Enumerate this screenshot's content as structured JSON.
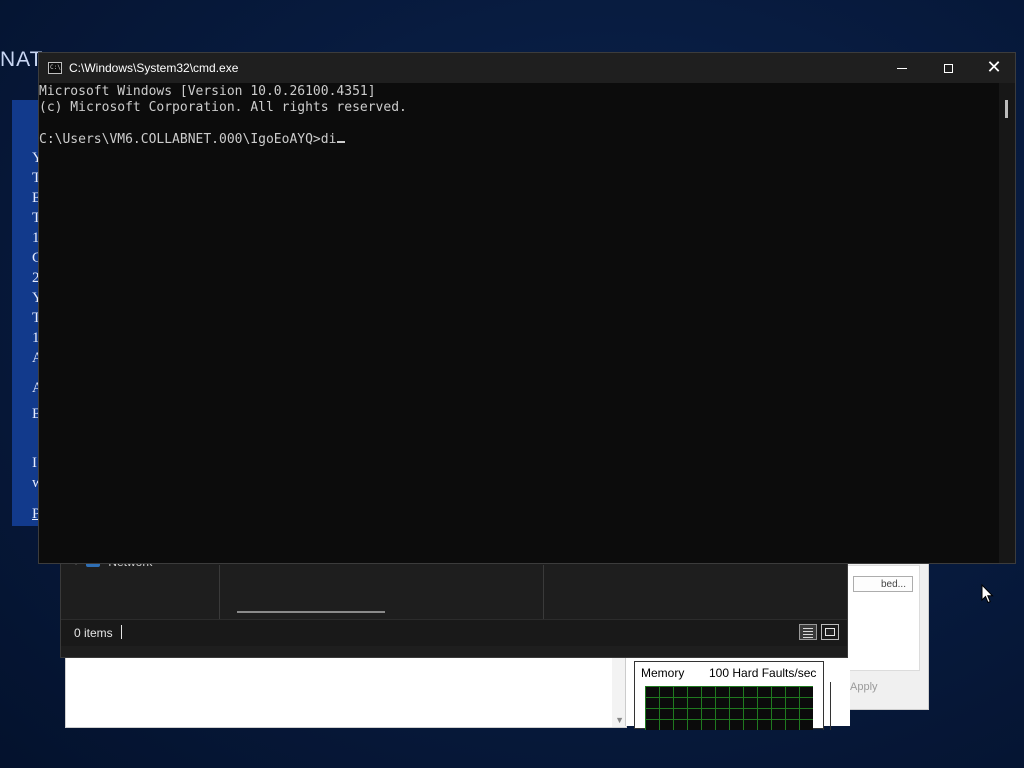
{
  "background_windows": {
    "nat_title": "NAT",
    "blue_window_lines": [
      "Y",
      "T",
      "E",
      "T",
      "1",
      "C",
      "2",
      "Y",
      "T",
      "1",
      "A",
      "A",
      "E",
      "I",
      "w",
      "P"
    ],
    "explorer": {
      "nav_item": "Network",
      "status_items": "0 items"
    },
    "properties": {
      "browse_label": "bed...",
      "apply_label": "Apply"
    },
    "perf_monitor": {
      "memory_label": "Memory",
      "faults_label": "100 Hard Faults/sec"
    }
  },
  "cmd": {
    "title": "C:\\Windows\\System32\\cmd.exe",
    "icon_text": "C:\\",
    "controls": {
      "minimize": "minimize",
      "maximize": "maximize",
      "close": "✕"
    },
    "lines": [
      "Microsoft Windows [Version 10.0.26100.4351]",
      "(c) Microsoft Corporation. All rights reserved."
    ],
    "prompt": "C:\\Users\\VM6.COLLABNET.000\\IgoEoAYQ>",
    "typed_input": "di"
  },
  "colors": {
    "desktop": "#071a3d",
    "console_bg": "#0c0c0c",
    "console_fg": "#cccccc",
    "titlebar": "#1f1f1f",
    "blue_window": "#123a8c"
  }
}
